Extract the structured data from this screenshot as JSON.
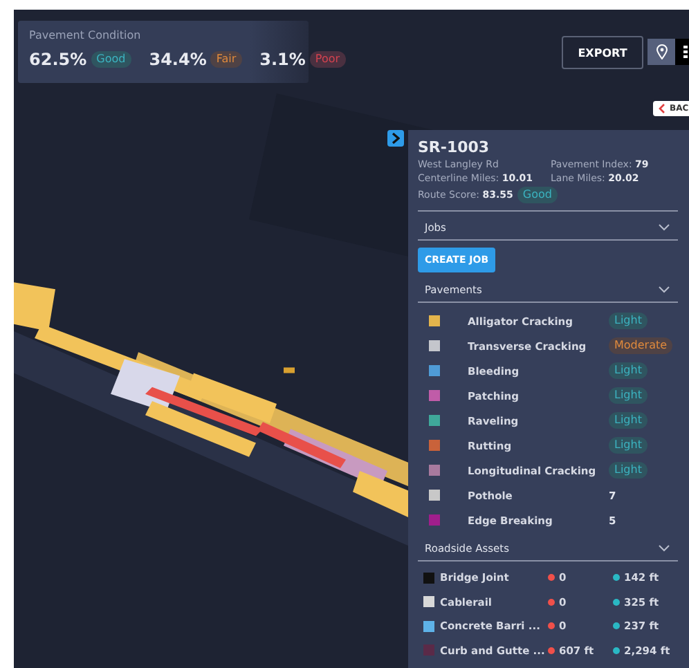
{
  "condition": {
    "title": "Pavement Condition",
    "items": [
      {
        "value": "62.5%",
        "badge": "Good",
        "kind": "good"
      },
      {
        "value": "34.4%",
        "badge": "Fair",
        "kind": "fair"
      },
      {
        "value": "3.1%",
        "badge": "Poor",
        "kind": "poor"
      }
    ]
  },
  "toolbar": {
    "export": "EXPORT",
    "views": [
      {
        "kind": "pin",
        "selected": true
      },
      {
        "kind": "grid",
        "selected": false
      }
    ],
    "back": "BAC"
  },
  "panel": {
    "title": "SR-1003",
    "road": "West Langley Rd",
    "fields": [
      {
        "label": "Pavement Index:",
        "value": "79"
      },
      {
        "label": "Centerline Miles:",
        "value": "10.01"
      },
      {
        "label": "Lane Miles:",
        "value": "20.02"
      }
    ],
    "score": {
      "label": "Route Score:",
      "value": "83.55",
      "badge": "Good",
      "kind": "good"
    },
    "jobs": {
      "title": "Jobs",
      "button": "CREATE JOB"
    },
    "pavements": {
      "title": "Pavements",
      "items": [
        {
          "name": "Alligator Cracking",
          "color": "#e3b44c",
          "kind": "light",
          "value": "Light"
        },
        {
          "name": "Transverse Cracking",
          "color": "#c4c6cc",
          "kind": "moderate",
          "value": "Moderate"
        },
        {
          "name": "Bleeding",
          "color": "#4f9bd6",
          "kind": "light",
          "value": "Light"
        },
        {
          "name": "Patching",
          "color": "#c05ca8",
          "kind": "light",
          "value": "Light"
        },
        {
          "name": "Raveling",
          "color": "#3fa89a",
          "kind": "light",
          "value": "Light"
        },
        {
          "name": "Rutting",
          "color": "#c9623a",
          "kind": "light",
          "value": "Light"
        },
        {
          "name": "Longitudinal Cracking",
          "color": "#a87a9e",
          "kind": "light",
          "value": "Light"
        },
        {
          "name": "Pothole",
          "color": "#c8c8c8",
          "kind": "count",
          "value": "7"
        },
        {
          "name": "Edge Breaking",
          "color": "#a01e8c",
          "kind": "count",
          "value": "5"
        }
      ]
    },
    "assets": {
      "title": "Roadside Assets",
      "items": [
        {
          "name": "Bridge Joint",
          "color": "#111111",
          "red": "0",
          "teal": "142 ft"
        },
        {
          "name": "Cablerail",
          "color": "#d8d8d8",
          "red": "0",
          "teal": "325 ft"
        },
        {
          "name": "Concrete Barri ...",
          "color": "#5eb2e8",
          "red": "0",
          "teal": "237 ft"
        },
        {
          "name": "Curb and Gutte ...",
          "color": "#5a2a48",
          "red": "607 ft",
          "teal": "2,294 ft"
        }
      ]
    }
  }
}
